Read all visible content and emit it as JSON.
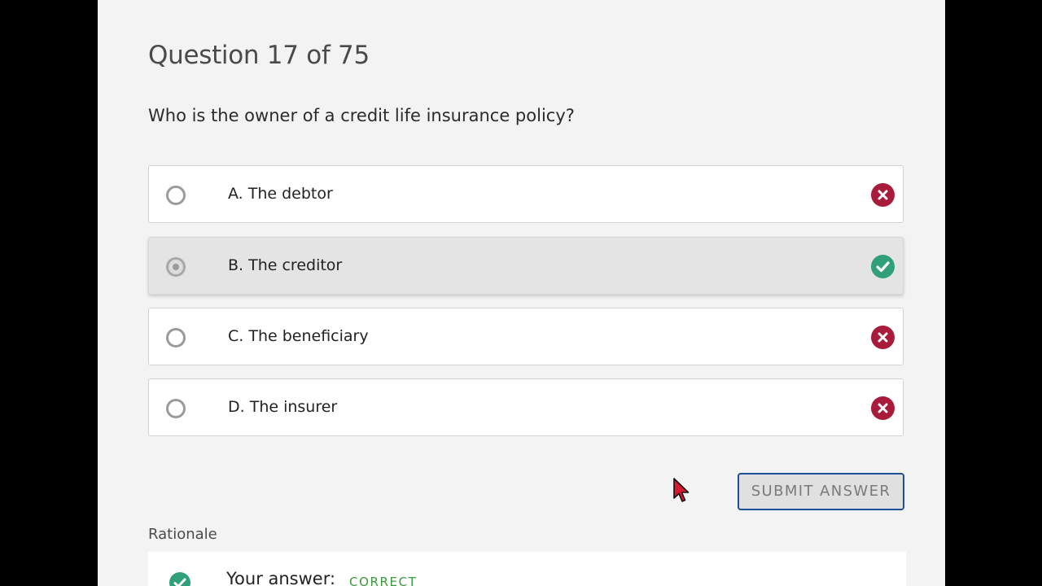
{
  "question": {
    "number_label": "Question 17 of 75",
    "text": "Who is the owner of a credit life insurance policy?"
  },
  "options": [
    {
      "label": "A. The debtor",
      "selected": false,
      "status_icon": "x-icon",
      "status": "incorrect"
    },
    {
      "label": "B. The creditor",
      "selected": true,
      "status_icon": "check-icon",
      "status": "correct"
    },
    {
      "label": "C. The beneficiary",
      "selected": false,
      "status_icon": "x-icon",
      "status": "incorrect"
    },
    {
      "label": "D. The insurer",
      "selected": false,
      "status_icon": "x-icon",
      "status": "incorrect"
    }
  ],
  "submit": {
    "label": "SUBMIT ANSWER"
  },
  "rationale": {
    "title": "Rationale",
    "your_answer_label": "Your answer:",
    "result": "CORRECT"
  },
  "colors": {
    "incorrect": "#a81b3a",
    "correct": "#2fa07a",
    "submit_border": "#1d4f9a",
    "result_text": "#3a9a3a"
  }
}
